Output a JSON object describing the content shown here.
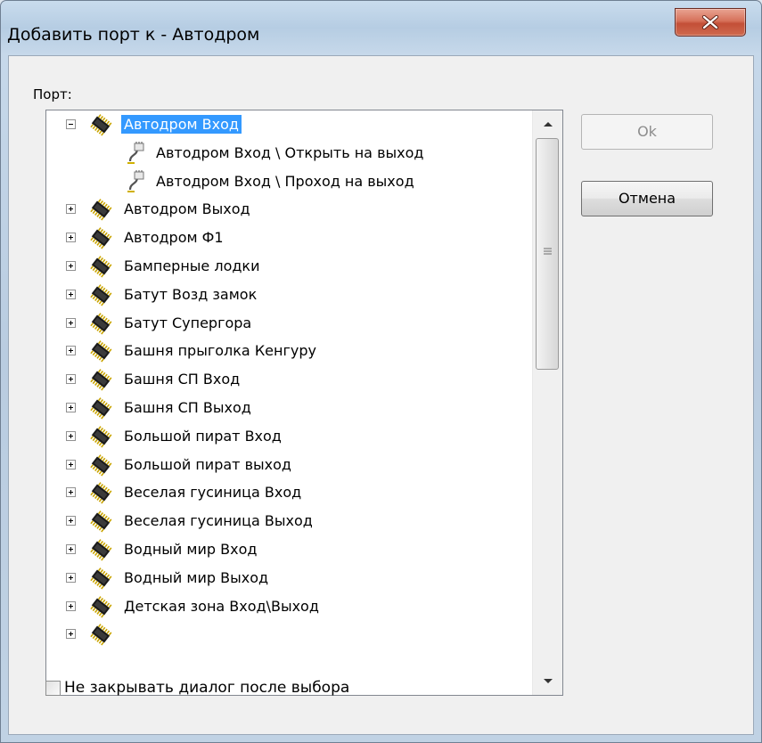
{
  "window": {
    "title": "Добавить порт к - Автодром",
    "close_icon": "close-icon"
  },
  "port_label": "Порт:",
  "tree": {
    "items": [
      {
        "label": "Автодром Вход",
        "expanded": true,
        "selected": true,
        "level": 0,
        "icon": "device-icon"
      },
      {
        "label": "Автодром Вход \\ Открыть на выход",
        "level": 1,
        "icon": "port-icon"
      },
      {
        "label": "Автодром Вход \\ Проход на выход",
        "level": 1,
        "icon": "port-icon"
      },
      {
        "label": "Автодром Выход",
        "expanded": false,
        "level": 0,
        "icon": "device-icon"
      },
      {
        "label": "Автодром Ф1",
        "expanded": false,
        "level": 0,
        "icon": "device-icon"
      },
      {
        "label": "Бамперные лодки",
        "expanded": false,
        "level": 0,
        "icon": "device-icon"
      },
      {
        "label": "Батут Возд замок",
        "expanded": false,
        "level": 0,
        "icon": "device-icon"
      },
      {
        "label": "Батут Супергора",
        "expanded": false,
        "level": 0,
        "icon": "device-icon"
      },
      {
        "label": "Башня прыголка Кенгуру",
        "expanded": false,
        "level": 0,
        "icon": "device-icon"
      },
      {
        "label": "Башня СП Вход",
        "expanded": false,
        "level": 0,
        "icon": "device-icon"
      },
      {
        "label": "Башня СП Выход",
        "expanded": false,
        "level": 0,
        "icon": "device-icon"
      },
      {
        "label": "Большой пират Вход",
        "expanded": false,
        "level": 0,
        "icon": "device-icon"
      },
      {
        "label": "Большой пират выход",
        "expanded": false,
        "level": 0,
        "icon": "device-icon"
      },
      {
        "label": "Веселая гусиница Вход",
        "expanded": false,
        "level": 0,
        "icon": "device-icon"
      },
      {
        "label": "Веселая гусиница Выход",
        "expanded": false,
        "level": 0,
        "icon": "device-icon"
      },
      {
        "label": "Водный мир Вход",
        "expanded": false,
        "level": 0,
        "icon": "device-icon"
      },
      {
        "label": "Водный мир Выход",
        "expanded": false,
        "level": 0,
        "icon": "device-icon"
      },
      {
        "label": "Детская зона Вход\\Выход",
        "expanded": false,
        "level": 0,
        "icon": "device-icon"
      },
      {
        "label": "",
        "expanded": false,
        "level": 0,
        "icon": "device-icon"
      }
    ]
  },
  "buttons": {
    "ok": "Ok",
    "ok_enabled": false,
    "cancel": "Отмена"
  },
  "checkbox": {
    "label": "Не закрывать диалог после выбора",
    "checked": false
  },
  "colors": {
    "selection": "#3399ff",
    "close_button": "#c75a41"
  }
}
